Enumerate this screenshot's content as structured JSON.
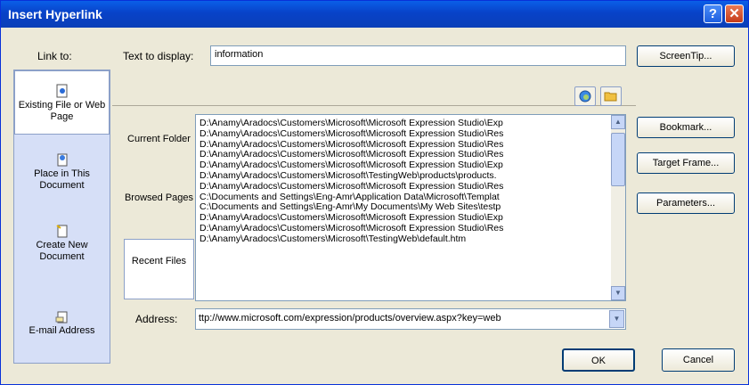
{
  "window": {
    "title": "Insert Hyperlink",
    "help_glyph": "?",
    "close_glyph": "✕"
  },
  "link_to": {
    "label": "Link to:",
    "items": [
      {
        "label": "Existing File or Web Page",
        "icon": "web-page-icon",
        "selected": true
      },
      {
        "label": "Place in This Document",
        "icon": "document-place-icon",
        "selected": false
      },
      {
        "label": "Create New Document",
        "icon": "new-document-icon",
        "selected": false
      },
      {
        "label": "E-mail Address",
        "icon": "email-icon",
        "selected": false
      }
    ]
  },
  "text_to_display": {
    "label": "Text to display:",
    "value": "information"
  },
  "buttons": {
    "screentip": "ScreenTip...",
    "bookmark": "Bookmark...",
    "target_frame": "Target Frame...",
    "parameters": "Parameters...",
    "ok": "OK",
    "cancel": "Cancel"
  },
  "nav": {
    "items": [
      {
        "label": "Current Folder",
        "selected": false
      },
      {
        "label": "Browsed Pages",
        "selected": false
      },
      {
        "label": "Recent Files",
        "selected": true
      }
    ]
  },
  "files": [
    "D:\\Anamy\\Aradocs\\Customers\\Microsoft\\Microsoft Expression Studio\\Exp",
    "D:\\Anamy\\Aradocs\\Customers\\Microsoft\\Microsoft Expression Studio\\Res",
    "D:\\Anamy\\Aradocs\\Customers\\Microsoft\\Microsoft Expression Studio\\Res",
    "D:\\Anamy\\Aradocs\\Customers\\Microsoft\\Microsoft Expression Studio\\Res",
    "D:\\Anamy\\Aradocs\\Customers\\Microsoft\\Microsoft Expression Studio\\Exp",
    "D:\\Anamy\\Aradocs\\Customers\\Microsoft\\TestingWeb\\products\\products.",
    "D:\\Anamy\\Aradocs\\Customers\\Microsoft\\Microsoft Expression Studio\\Res",
    "C:\\Documents and Settings\\Eng-Amr\\Application Data\\Microsoft\\Templat",
    "C:\\Documents and Settings\\Eng-Amr\\My Documents\\My Web Sites\\testp",
    "D:\\Anamy\\Aradocs\\Customers\\Microsoft\\Microsoft Expression Studio\\Exp",
    "D:\\Anamy\\Aradocs\\Customers\\Microsoft\\Microsoft Expression Studio\\Res",
    "D:\\Anamy\\Aradocs\\Customers\\Microsoft\\TestingWeb\\default.htm"
  ],
  "address": {
    "label": "Address:",
    "value": "ttp://www.microsoft.com/expression/products/overview.aspx?key=web"
  }
}
